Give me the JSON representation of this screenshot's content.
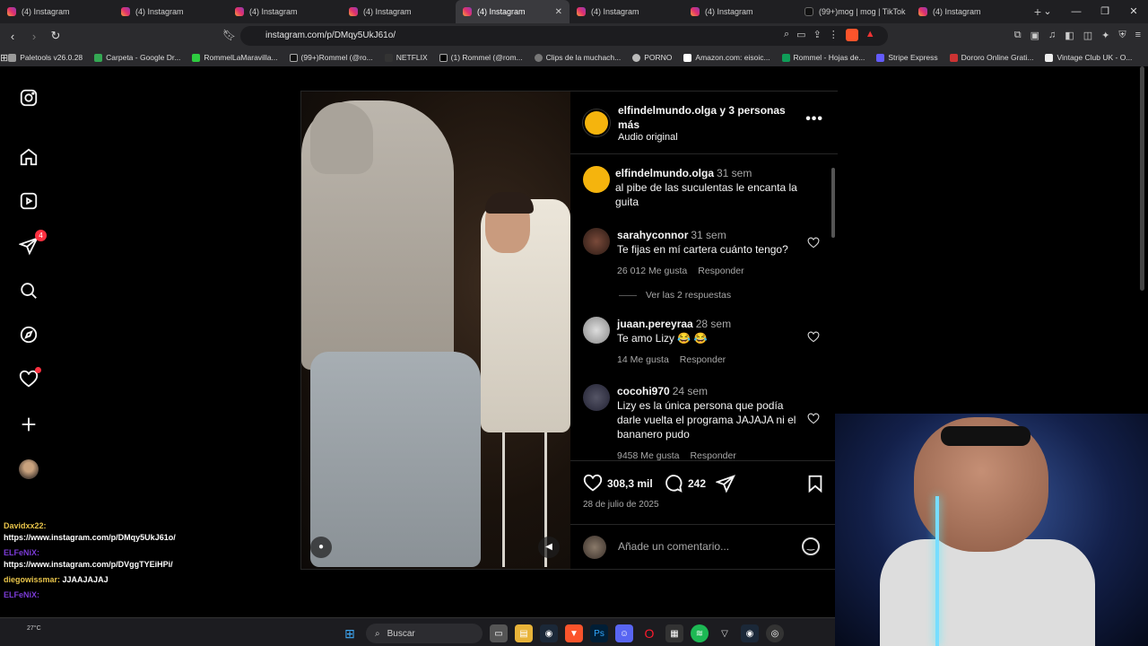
{
  "tabs": [
    {
      "label": "(4) Instagram",
      "icon": "instagram-icon"
    },
    {
      "label": "(4) Instagram",
      "icon": "instagram-icon"
    },
    {
      "label": "(4) Instagram",
      "icon": "instagram-icon"
    },
    {
      "label": "(4) Instagram",
      "icon": "instagram-icon"
    },
    {
      "label": "(4) Instagram",
      "icon": "instagram-icon",
      "active": true
    },
    {
      "label": "(4) Instagram",
      "icon": "instagram-icon"
    },
    {
      "label": "(4) Instagram",
      "icon": "instagram-icon"
    },
    {
      "label": "(99+)mog | mog | TikTok",
      "icon": "tiktok-icon"
    },
    {
      "label": "(4) Instagram",
      "icon": "instagram-icon"
    }
  ],
  "address": {
    "url": "instagram.com/p/DMqy5UkJ61o/"
  },
  "bookmarks": [
    "Paletools v26.0.28",
    "Carpeta - Google Dr...",
    "RommelLaMaravilla...",
    "(99+)Rommel (@ro...",
    "NETFLIX",
    "(1) Rommel (@rom...",
    "Clips de la muchach...",
    "PORNO",
    "Amazon.com: eisoic...",
    "Rommel - Hojas de...",
    "Stripe Express",
    "Dororo Online Grati...",
    "Vintage Club UK - O..."
  ],
  "sidenav": {
    "notifications_badge": "4"
  },
  "post": {
    "header_user": "elfindelmundo.olga y 3 personas más",
    "audio": "Audio original",
    "comments": [
      {
        "user": "elfindelmundo.olga",
        "time": "31 sem",
        "text": "al pibe de las suculentas le encanta la guita"
      },
      {
        "user": "sarahyconnor",
        "time": "31 sem",
        "text": "Te fijas en mí cartera cuánto tengo?",
        "likes": "26 012 Me gusta",
        "reply": "Responder"
      },
      {
        "user": "juaan.pereyraa",
        "time": "28 sem",
        "text": "Te amo Lizy 😂 😂",
        "likes": "14 Me gusta",
        "reply": "Responder"
      },
      {
        "user": "cocohi970",
        "time": "24 sem",
        "text": "Lizy es la única persona que podía darle vuelta el programa JAJAJA ni el bananero pudo",
        "likes": "9458 Me gusta",
        "reply": "Responder"
      }
    ],
    "view_replies": "Ver las 2 respuestas",
    "like_count": "308,3 mil",
    "comment_count": "242",
    "date": "28 de julio de 2025",
    "add_comment_placeholder": "Añade un comentario..."
  },
  "chat": [
    {
      "user": "Davidxx22:",
      "text": "https://www.instagram.com/p/DMqy5UkJ61o/"
    },
    {
      "user": "ELFeNiX:",
      "text": "https://www.instagram.com/p/DVggTYEiHPi/"
    },
    {
      "user": "diegowissmar:",
      "text": "JJAAJAJAJ"
    },
    {
      "user": "ELFeNiX:",
      "text": ""
    }
  ],
  "taskbar": {
    "search_label": "Buscar",
    "weather": "27°C"
  }
}
